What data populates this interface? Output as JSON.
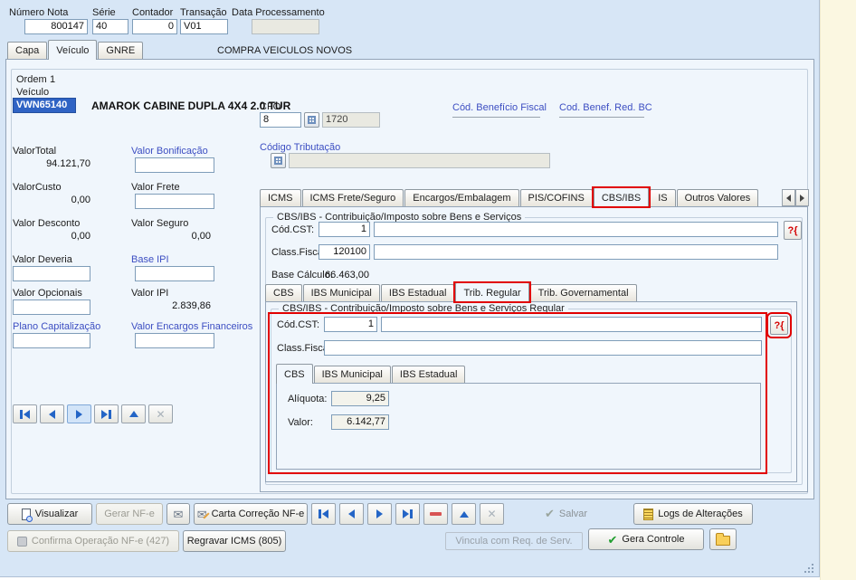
{
  "palette": {
    "window_bg": "#d7e6f6",
    "page_bg": "#f0f6fc",
    "field_border": "#7f9db9",
    "disabled_bg": "#e9e9e1",
    "blue_label": "#3c4ec2",
    "annotation_red": "#e10000",
    "nav_arrow_blue": "#2465c6",
    "check_green": "#1f9e2e",
    "selection_blue": "#2f63c4"
  },
  "icons": {
    "envelope": "✉",
    "check": "✔",
    "cancel": "✕"
  },
  "header": {
    "fields": [
      {
        "label": "Número Nota",
        "value": "800147"
      },
      {
        "label": "Série",
        "value": "40"
      },
      {
        "label": "Contador",
        "value": "0"
      },
      {
        "label": "Transação",
        "value": "V01"
      },
      {
        "label": "Data Processamento",
        "value": ""
      }
    ]
  },
  "main_tabs": {
    "items": [
      {
        "label": "Capa"
      },
      {
        "label": "Veículo"
      },
      {
        "label": "GNRE"
      }
    ],
    "selected": "Veículo",
    "description": "COMPRA VEICULOS NOVOS"
  },
  "vehicle": {
    "ordem_label": "Ordem",
    "ordem_value": "1",
    "veiculo_label": "Veículo",
    "veiculo_code": "VWN65140",
    "veiculo_name": "AMAROK CABINE DUPLA 4X4 2.0 TUR",
    "cfo_label": "CFO",
    "cfo_value": "8",
    "cfo_code": "1720",
    "cod_beneficio_fiscal_label": "Cód. Benefício Fiscal",
    "cod_benef_red_bc_label": "Cod. Benef. Red. BC",
    "codigo_tributacao_label": "Código Tributação",
    "codigo_tributacao_value": "",
    "left_fields": [
      {
        "label": "ValorTotal",
        "value": "94.121,70"
      },
      {
        "label": "ValorCusto",
        "value": "0,00"
      },
      {
        "label": "Valor Desconto",
        "value": "0,00"
      },
      {
        "label": "Valor Deveria",
        "value": ""
      },
      {
        "label": "Valor Opcionais",
        "value": ""
      },
      {
        "label": "Plano Capitalização",
        "value": ""
      }
    ],
    "mid_fields": [
      {
        "label": "Valor Bonificação",
        "value": ""
      },
      {
        "label": "Valor Frete",
        "value": ""
      },
      {
        "label": "Valor Seguro",
        "value": "0,00"
      },
      {
        "label": "Base IPI",
        "value": ""
      },
      {
        "label": "Valor IPI",
        "value": "2.839,86"
      },
      {
        "label": "Valor Encargos Financeiros",
        "value": ""
      }
    ]
  },
  "tax_tabs": {
    "items": [
      {
        "label": "ICMS"
      },
      {
        "label": "ICMS Frete/Seguro"
      },
      {
        "label": "Encargos/Embalagem"
      },
      {
        "label": "PIS/COFINS"
      },
      {
        "label": "CBS/IBS"
      },
      {
        "label": "IS"
      },
      {
        "label": "Outros Valores"
      }
    ],
    "selected": "CBS/IBS"
  },
  "cbs_ibs": {
    "group_title": "CBS/IBS -  Contribuição/Imposto sobre Bens e Serviços",
    "cod_cst_label": "Cód.CST:",
    "cod_cst_value": "1",
    "cod_cst_desc": "",
    "class_fiscal_label": "Class.Fiscal:",
    "class_fiscal_value": "120100",
    "class_fiscal_desc": "",
    "base_calculo_label": "Base Cálculo:",
    "base_calculo_value": "66.463,00",
    "help_button": "?{"
  },
  "sub_tabs": {
    "items": [
      {
        "label": "CBS"
      },
      {
        "label": "IBS Municipal"
      },
      {
        "label": "IBS Estadual"
      },
      {
        "label": "Trib. Regular"
      },
      {
        "label": "Trib. Governamental"
      }
    ],
    "selected": "Trib. Regular"
  },
  "regular": {
    "group_title": "CBS/IBS -  Contribuição/Imposto sobre Bens e Serviços Regular",
    "cod_cst_label": "Cód.CST:",
    "cod_cst_value": "1",
    "cod_cst_desc": "",
    "class_fiscal_label": "Class.Fiscal:",
    "class_fiscal_value": "",
    "help_button": "?{",
    "inner_tabs": {
      "items": [
        {
          "label": "CBS"
        },
        {
          "label": "IBS Municipal"
        },
        {
          "label": "IBS Estadual"
        }
      ],
      "selected": "CBS"
    },
    "aliquota_label": "Alíquota:",
    "aliquota_value": "9,25",
    "valor_label": "Valor:",
    "valor_value": "6.142,77"
  },
  "toolbar": {
    "visualizar": "Visualizar",
    "gerar_nfe": "Gerar NF-e",
    "carta_correcao": "Carta Correção NF-e",
    "salvar": "Salvar",
    "logs": "Logs de Alterações",
    "confirma_operacao": "Confirma Operação NF-e (427)",
    "regravar_icms": "Regravar ICMS (805)",
    "vincula_req": "Vincula com Req. de Serv.",
    "gera_controle": "Gera Controle"
  }
}
